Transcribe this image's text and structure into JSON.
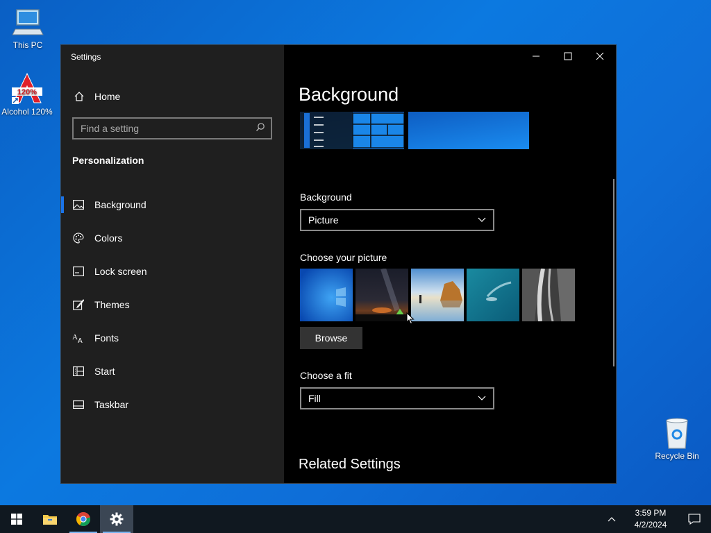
{
  "desktop": {
    "icons": [
      {
        "label": "This PC"
      },
      {
        "label": "Alcohol 120%"
      },
      {
        "label": "Recycle Bin"
      }
    ]
  },
  "window": {
    "title": "Settings",
    "caption": {
      "minimize": "minimize-icon",
      "maximize": "maximize-icon",
      "close": "close-icon"
    }
  },
  "sidebar": {
    "home_label": "Home",
    "search_placeholder": "Find a setting",
    "section_title": "Personalization",
    "items": [
      {
        "label": "Background",
        "icon": "picture-icon",
        "active": true
      },
      {
        "label": "Colors",
        "icon": "palette-icon",
        "active": false
      },
      {
        "label": "Lock screen",
        "icon": "lock-screen-icon",
        "active": false
      },
      {
        "label": "Themes",
        "icon": "brush-icon",
        "active": false
      },
      {
        "label": "Fonts",
        "icon": "fonts-icon",
        "active": false
      },
      {
        "label": "Start",
        "icon": "start-icon",
        "active": false
      },
      {
        "label": "Taskbar",
        "icon": "taskbar-icon",
        "active": false
      }
    ]
  },
  "main": {
    "title": "Background",
    "background_label": "Background",
    "background_value": "Picture",
    "choose_picture_label": "Choose your picture",
    "browse_label": "Browse",
    "fit_label": "Choose a fit",
    "fit_value": "Fill",
    "related_title": "Related Settings"
  },
  "taskbar": {
    "apps": [
      "start-icon",
      "file-explorer-icon",
      "chrome-icon",
      "settings-icon"
    ],
    "time": "3:59 PM",
    "date": "4/2/2024"
  },
  "colors": {
    "accent": "#1a73e8",
    "sidebar_bg": "#1f1f1f",
    "content_bg": "#000000"
  }
}
